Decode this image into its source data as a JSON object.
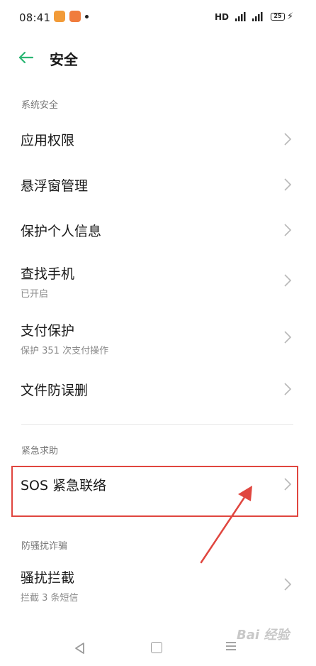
{
  "status_bar": {
    "time": "08:41",
    "network": "HD",
    "battery": "25"
  },
  "header": {
    "title": "安全"
  },
  "sections": [
    {
      "title": "系统安全"
    },
    {
      "title": "紧急求助"
    },
    {
      "title": "防骚扰诈骗"
    }
  ],
  "items": [
    {
      "label": "应用权限",
      "sub": ""
    },
    {
      "label": "悬浮窗管理",
      "sub": ""
    },
    {
      "label": "保护个人信息",
      "sub": ""
    },
    {
      "label": "查找手机",
      "sub": "已开启"
    },
    {
      "label": "支付保护",
      "sub": "保护 351 次支付操作"
    },
    {
      "label": "文件防误删",
      "sub": ""
    },
    {
      "label": "SOS 紧急联络",
      "sub": ""
    },
    {
      "label": "骚扰拦截",
      "sub": "拦截 3 条短信"
    }
  ],
  "watermark": "Bai 经验",
  "colors": {
    "accent": "#2bb673",
    "highlight": "#e0463f"
  }
}
